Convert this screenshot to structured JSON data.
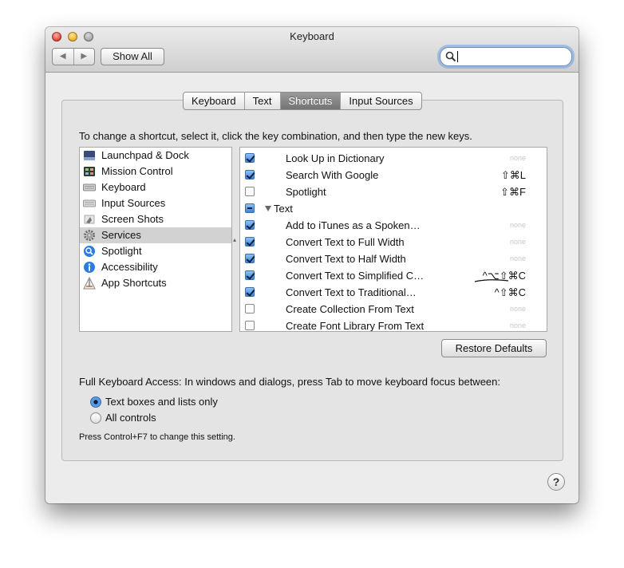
{
  "window": {
    "title": "Keyboard"
  },
  "toolbar": {
    "back_label": "◀",
    "forward_label": "▶",
    "show_all_label": "Show All"
  },
  "search": {
    "value": ""
  },
  "tabs": [
    {
      "label": "Keyboard",
      "active": false
    },
    {
      "label": "Text",
      "active": false
    },
    {
      "label": "Shortcuts",
      "active": true
    },
    {
      "label": "Input Sources",
      "active": false
    }
  ],
  "instruction": "To change a shortcut, select it, click the key combination, and then type the new keys.",
  "categories": [
    {
      "label": "Launchpad & Dock",
      "icon": "launchpad-icon"
    },
    {
      "label": "Mission Control",
      "icon": "mission-control-icon"
    },
    {
      "label": "Keyboard",
      "icon": "keyboard-icon"
    },
    {
      "label": "Input Sources",
      "icon": "input-sources-icon"
    },
    {
      "label": "Screen Shots",
      "icon": "screenshot-icon"
    },
    {
      "label": "Services",
      "icon": "gear-icon",
      "selected": true
    },
    {
      "label": "Spotlight",
      "icon": "spotlight-icon"
    },
    {
      "label": "Accessibility",
      "icon": "accessibility-icon"
    },
    {
      "label": "App Shortcuts",
      "icon": "app-shortcuts-icon"
    }
  ],
  "services": [
    {
      "name": "Look Up in Dictionary",
      "state": "on",
      "shortcut": "none"
    },
    {
      "name": "Search With Google",
      "state": "on",
      "shortcut": "⇧⌘L"
    },
    {
      "name": "Spotlight",
      "state": "off",
      "shortcut": "⇧⌘F"
    },
    {
      "name": "Text",
      "state": "mixed",
      "group": true,
      "shortcut": ""
    },
    {
      "name": "Add to iTunes as a Spoken…",
      "state": "on",
      "shortcut": "none"
    },
    {
      "name": "Convert Text to Full Width",
      "state": "on",
      "shortcut": "none"
    },
    {
      "name": "Convert Text to Half Width",
      "state": "on",
      "shortcut": "none"
    },
    {
      "name": "Convert Text to Simplified C…",
      "state": "on",
      "shortcut": "^⌥⇧⌘C"
    },
    {
      "name": "Convert Text to Traditional…",
      "state": "on",
      "shortcut": "^⇧⌘C"
    },
    {
      "name": "Create Collection From Text",
      "state": "off",
      "shortcut": "none"
    },
    {
      "name": "Create Font Library From Text",
      "state": "off",
      "shortcut": "none"
    }
  ],
  "restore_defaults_label": "Restore Defaults",
  "full_keyboard_access": {
    "label": "Full Keyboard Access: In windows and dialogs, press Tab to move keyboard focus between:",
    "options": [
      {
        "label": "Text boxes and lists only",
        "selected": true
      },
      {
        "label": "All controls",
        "selected": false
      }
    ],
    "note": "Press Control+F7 to change this setting."
  },
  "help_label": "?"
}
